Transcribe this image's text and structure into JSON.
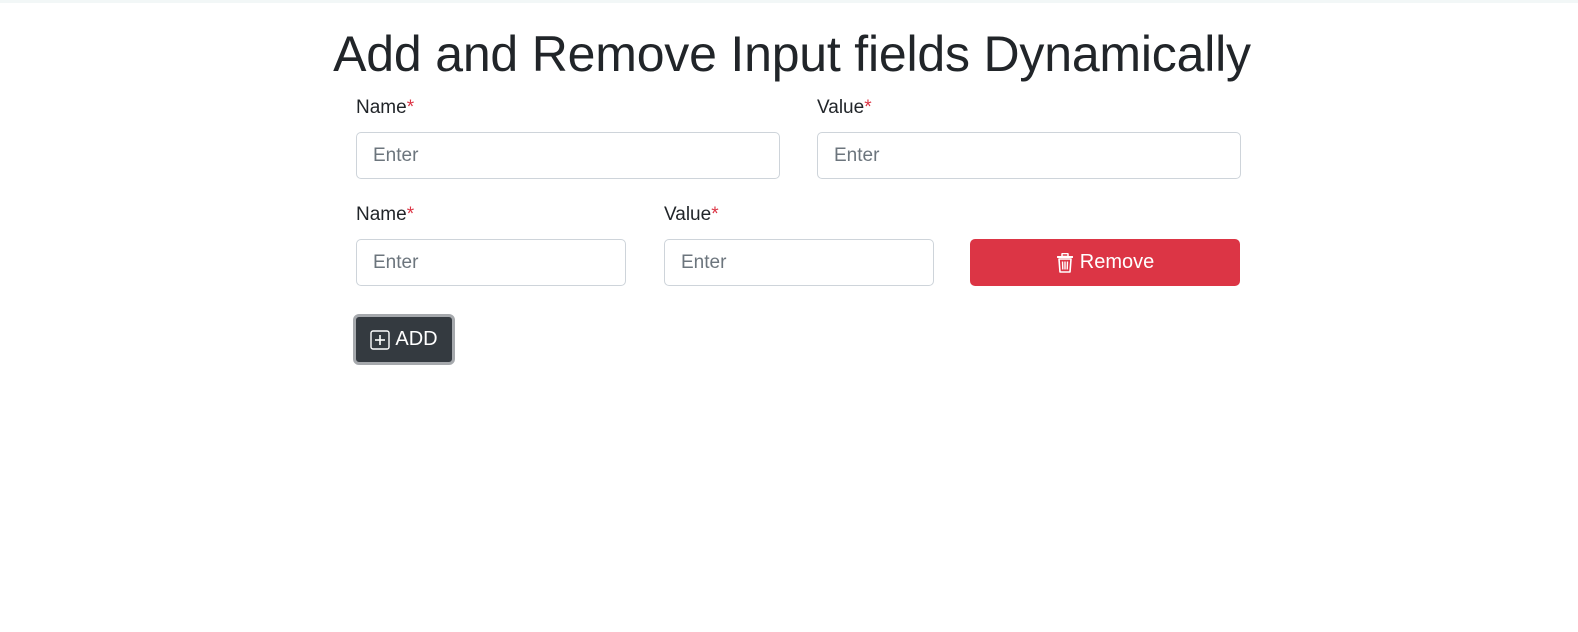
{
  "page": {
    "title": "Add and Remove Input fields Dynamically"
  },
  "rows": [
    {
      "name": {
        "label": "Name",
        "required_mark": "*",
        "placeholder": "Enter",
        "value": ""
      },
      "value": {
        "label": "Value",
        "required_mark": "*",
        "placeholder": "Enter",
        "value": ""
      }
    },
    {
      "name": {
        "label": "Name",
        "required_mark": "*",
        "placeholder": "Enter",
        "value": ""
      },
      "value": {
        "label": "Value",
        "required_mark": "*",
        "placeholder": "Enter",
        "value": ""
      },
      "remove": {
        "label": "Remove",
        "icon": "trash-icon"
      }
    }
  ],
  "add_button": {
    "label": "ADD",
    "icon": "plus-square-icon"
  },
  "colors": {
    "danger": "#dc3545",
    "dark": "#343a40",
    "text": "#212529",
    "placeholder": "#6c757d",
    "border": "#ced4da"
  }
}
